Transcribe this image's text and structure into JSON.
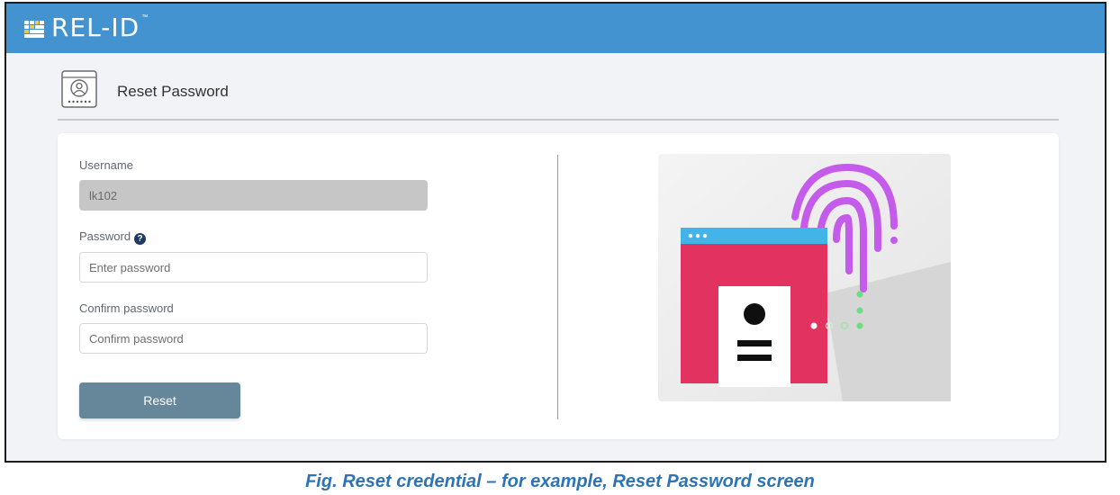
{
  "app": {
    "logo_text": "REL-ID",
    "logo_tm": "™"
  },
  "page": {
    "title": "Reset Password"
  },
  "form": {
    "username_label": "Username",
    "username_value": "lk102",
    "password_label": "Password",
    "password_placeholder": "Enter password",
    "confirm_label": "Confirm password",
    "confirm_placeholder": "Confirm password",
    "reset_label": "Reset"
  },
  "icons": {
    "logo": "rel-id-logo-mark",
    "header": "user-credential-icon",
    "help": "question-circle-icon",
    "illustration": "fingerprint-browser-illustration"
  },
  "colors": {
    "topbar": "#4293cf",
    "button": "#66869a",
    "caption": "#2e74b5"
  },
  "caption": "Fig. Reset credential – for example, Reset Password screen"
}
